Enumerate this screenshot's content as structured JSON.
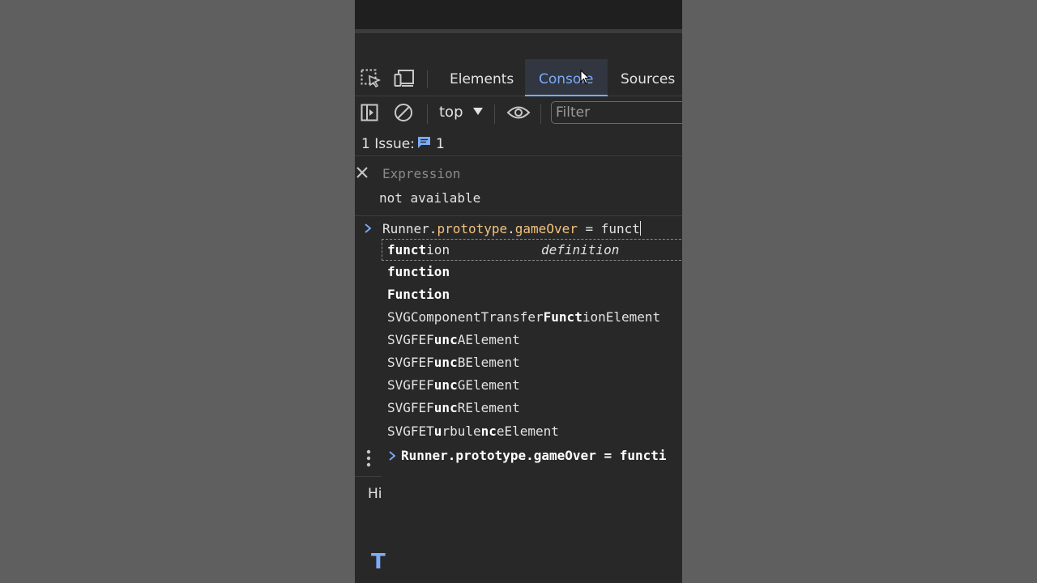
{
  "tabs": [
    {
      "label": "Elements"
    },
    {
      "label": "Console"
    },
    {
      "label": "Sources"
    }
  ],
  "toolbar": {
    "context": "top",
    "filter_placeholder": "Filter"
  },
  "issues": {
    "label": "1 Issue:",
    "count": "1"
  },
  "expression": {
    "label": "Expression",
    "value": "not available"
  },
  "input": {
    "object": "Runner.",
    "prototype": "prototype",
    "dot": ".",
    "method": "gameOver",
    "rest": " = funct"
  },
  "autocomplete": {
    "items": [
      {
        "pre": "",
        "bold": "funct",
        "post": "ion",
        "hint": "definition"
      },
      {
        "pre": "",
        "bold": "funct",
        "post": "ion"
      },
      {
        "pre": "",
        "bold": "Funct",
        "post": "ion"
      },
      {
        "pre": "SVGComponentTransfer",
        "bold": "Funct",
        "post": "ionElement"
      },
      {
        "pre": "SVGFEF",
        "bold": "unc",
        "post": "AElement"
      },
      {
        "pre": "SVGFEF",
        "bold": "unc",
        "post": "BElement"
      },
      {
        "pre": "SVGFEF",
        "bold": "unc",
        "post": "GElement"
      },
      {
        "pre": "SVGFEF",
        "bold": "unc",
        "post": "RElement"
      },
      {
        "pre": "SVGFET",
        "bold": "u",
        "post": "rbule",
        "bold2": "nc",
        "post2": "eElement"
      }
    ],
    "footer": "Runner.prototype.gameOver = functi"
  },
  "drawer": {
    "tab": "Hi",
    "letter": "T"
  },
  "colors": {
    "accent": "#7cacf8",
    "property": "#f2c27f",
    "background": "#282828"
  }
}
